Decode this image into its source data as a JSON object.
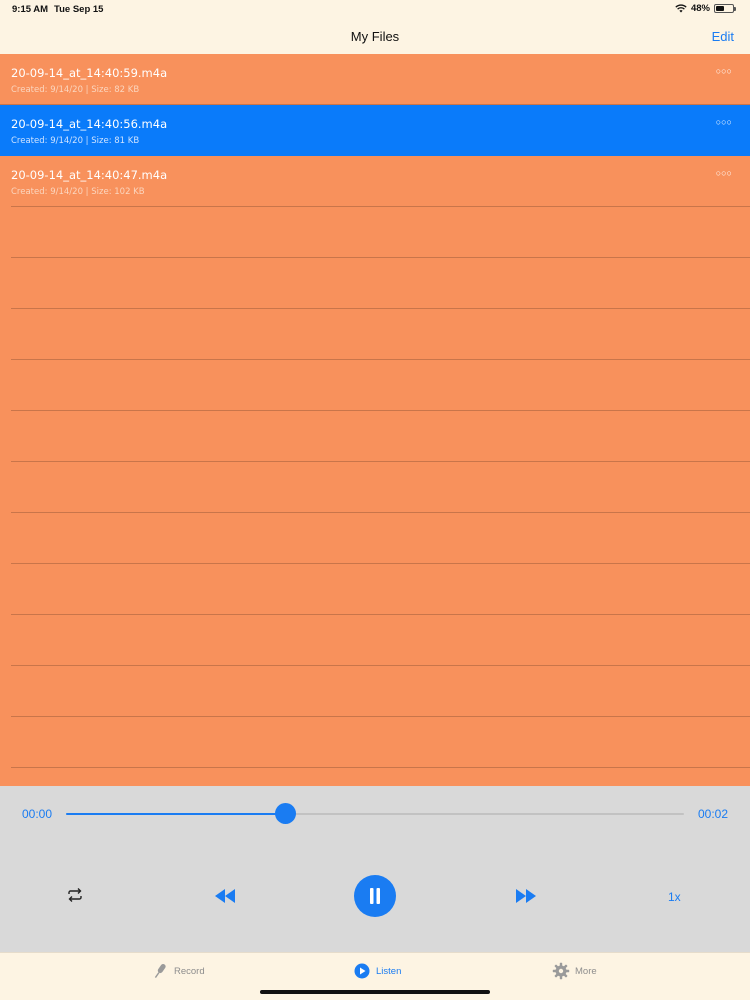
{
  "status_bar": {
    "time": "9:15 AM",
    "date": "Tue Sep 15",
    "battery": "48%",
    "battery_level": 0.48
  },
  "nav": {
    "title": "My Files",
    "edit_label": "Edit"
  },
  "files": [
    {
      "name": "20-09-14_at_14:40:59.m4a",
      "meta": "Created: 9/14/20 | Size: 82 KB",
      "selected": false
    },
    {
      "name": "20-09-14_at_14:40:56.m4a",
      "meta": "Created: 9/14/20 | Size: 81 KB",
      "selected": true
    },
    {
      "name": "20-09-14_at_14:40:47.m4a",
      "meta": "Created: 9/14/20 | Size: 102 KB",
      "selected": false
    }
  ],
  "more_glyph": "○○○",
  "player": {
    "current_time": "00:00",
    "total_time": "00:02",
    "progress": 0.355,
    "speed": "1x"
  },
  "tabs": {
    "record": "Record",
    "listen": "Listen",
    "more": "More"
  },
  "colors": {
    "accent": "#1a7cf2",
    "list_bg": "#f8915c",
    "selected_row": "#0a7bfa",
    "player_bg": "#d9d9d9",
    "bar_bg": "#fdf4e3"
  }
}
